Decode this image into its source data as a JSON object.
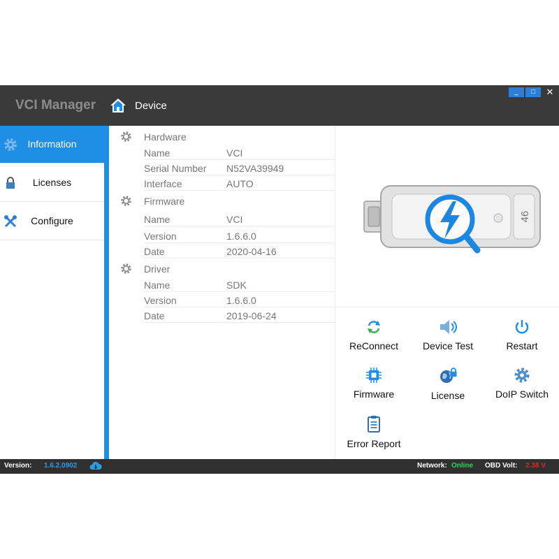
{
  "window": {
    "title": "VCI Manager",
    "breadcrumb": "Device",
    "controls": {
      "minimize": "_",
      "maximize": "□",
      "close": "✕"
    }
  },
  "sidebar": {
    "items": [
      {
        "label": "Information",
        "icon": "gear-icon",
        "active": true
      },
      {
        "label": "Licenses",
        "icon": "lock-icon",
        "active": false
      },
      {
        "label": "Configure",
        "icon": "tools-icon",
        "active": false
      }
    ]
  },
  "info": {
    "hardware": {
      "title": "Hardware",
      "rows": [
        {
          "key": "Name",
          "value": "VCI"
        },
        {
          "key": "Serial Number",
          "value": "N52VA39949"
        },
        {
          "key": "Interface",
          "value": "AUTO"
        }
      ]
    },
    "firmware": {
      "title": "Firmware",
      "rows": [
        {
          "key": "Name",
          "value": "VCI"
        },
        {
          "key": "Version",
          "value": "1.6.6.0"
        },
        {
          "key": "Date",
          "value": "2020-04-16"
        }
      ]
    },
    "driver": {
      "title": "Driver",
      "rows": [
        {
          "key": "Name",
          "value": "SDK"
        },
        {
          "key": "Version",
          "value": "1.6.6.0"
        },
        {
          "key": "Date",
          "value": "2019-06-24"
        }
      ]
    }
  },
  "device": {
    "label_text": "46"
  },
  "actions": {
    "reconnect": "ReConnect",
    "device_test": "Device Test",
    "restart": "Restart",
    "firmware": "Firmware",
    "license": "License",
    "doip_switch": "DoIP Switch",
    "error_report": "Error Report"
  },
  "status": {
    "version_label": "Version:",
    "version_value": "1.6.2.0902",
    "network_label": "Network:",
    "network_value": "Online",
    "obd_label": "OBD Volt:",
    "obd_value": "2.38 V"
  },
  "colors": {
    "accent": "#1e8fe4",
    "titlebar": "#3a3a3a",
    "statusbar": "#303030",
    "online": "#2fd35a",
    "volt": "#e22222"
  }
}
